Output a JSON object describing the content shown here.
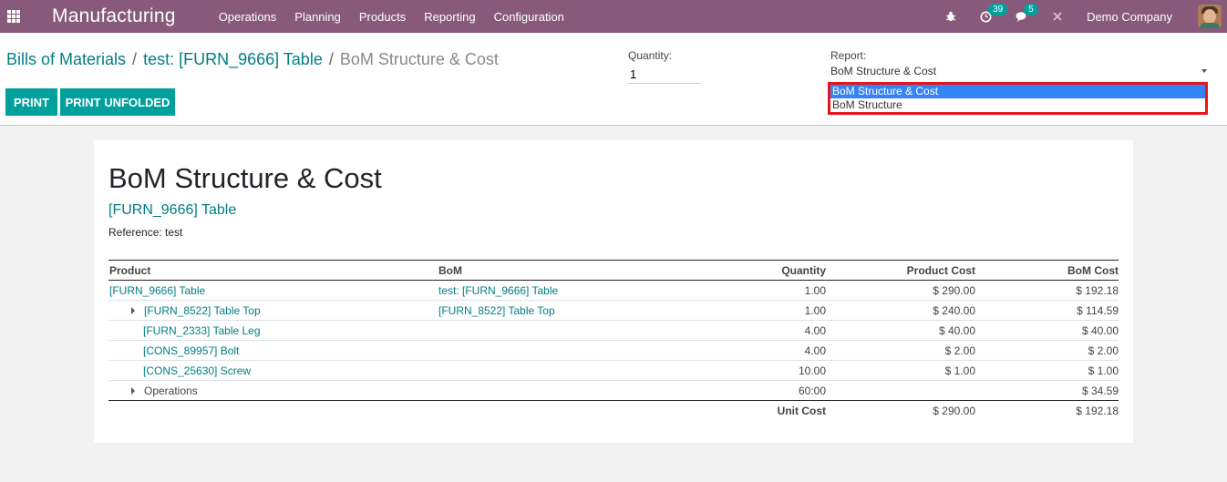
{
  "navbar": {
    "app_name": "Manufacturing",
    "menu": [
      "Operations",
      "Planning",
      "Products",
      "Reporting",
      "Configuration"
    ],
    "activity_count": "39",
    "message_count": "5",
    "company": "Demo Company"
  },
  "breadcrumb": {
    "root": "Bills of Materials",
    "bom": "test: [FURN_9666] Table",
    "current": "BoM Structure & Cost"
  },
  "buttons": {
    "print": "PRINT",
    "print_unfolded": "PRINT UNFOLDED"
  },
  "quantity": {
    "label": "Quantity:",
    "value": "1"
  },
  "report": {
    "label": "Report:",
    "selected": "BoM Structure & Cost",
    "options": [
      "BoM Structure & Cost",
      "BoM Structure"
    ]
  },
  "sheet": {
    "title": "BoM Structure & Cost",
    "product": "[FURN_9666] Table",
    "reference": "Reference: test",
    "columns": {
      "product": "Product",
      "bom": "BoM",
      "quantity": "Quantity",
      "product_cost": "Product Cost",
      "bom_cost": "BoM Cost"
    },
    "rows": [
      {
        "product": "[FURN_9666] Table",
        "bom": "test: [FURN_9666] Table",
        "quantity": "1.00",
        "product_cost": "$ 290.00",
        "bom_cost": "$ 192.18"
      },
      {
        "product": "[FURN_8522] Table Top",
        "bom": "[FURN_8522] Table Top",
        "quantity": "1.00",
        "product_cost": "$ 240.00",
        "bom_cost": "$ 114.59"
      },
      {
        "product": "[FURN_2333] Table Leg",
        "bom": "",
        "quantity": "4.00",
        "product_cost": "$ 40.00",
        "bom_cost": "$ 40.00"
      },
      {
        "product": "[CONS_89957] Bolt",
        "bom": "",
        "quantity": "4.00",
        "product_cost": "$ 2.00",
        "bom_cost": "$ 2.00"
      },
      {
        "product": "[CONS_25630] Screw",
        "bom": "",
        "quantity": "10.00",
        "product_cost": "$ 1.00",
        "bom_cost": "$ 1.00"
      },
      {
        "product": "Operations",
        "bom": "",
        "quantity": "60:00",
        "product_cost": "",
        "bom_cost": "$ 34.59"
      }
    ],
    "total": {
      "label": "Unit Cost",
      "product_cost": "$ 290.00",
      "bom_cost": "$ 192.18"
    }
  }
}
